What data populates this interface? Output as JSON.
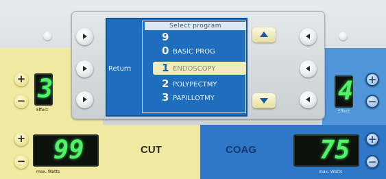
{
  "screen": {
    "title": "Select program",
    "return_label": "Return",
    "programs": [
      {
        "number": "9",
        "name": ""
      },
      {
        "number": "0",
        "name": "BASIC PROG"
      },
      {
        "number": "1",
        "name": "ENDOSCOPY"
      },
      {
        "number": "2",
        "name": "POLYPECTMY"
      },
      {
        "number": "3",
        "name": "PAPILLOTMY"
      }
    ],
    "selected_index": 2
  },
  "cut": {
    "label": "CUT",
    "effect_value": "3",
    "effect_label": "Effect",
    "watts_value": "99",
    "watts_label": "max. Watts",
    "color": "#f0e9a0"
  },
  "coag": {
    "label": "COAG",
    "effect_value": "4",
    "effect_label": "Effect",
    "watts_value": "75",
    "watts_label": "max. Watts",
    "color": "#2f78c7"
  },
  "buttons": {
    "plus": "+",
    "minus": "−"
  },
  "icons": {
    "left_softkeys": "arrow-right-icon",
    "right_softkeys": "arrow-left-icon",
    "scroll_up": "chevron-up-icon",
    "scroll_down": "chevron-down-icon"
  },
  "colors": {
    "lcd_background": "#1f6dbd",
    "selection_highlight": "#f2ecbc",
    "led_digits": "#55f06a"
  }
}
